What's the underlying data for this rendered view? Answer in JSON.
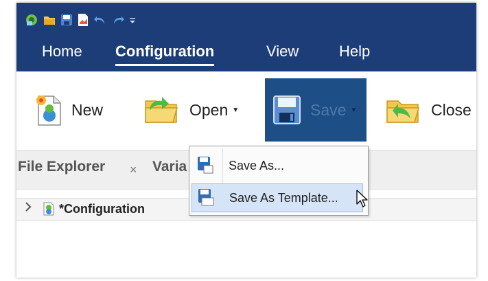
{
  "colors": {
    "titlebar": "#1d3d78",
    "save_active": "#1d4e86",
    "menu_highlight": "#d5e4f7"
  },
  "quick_access": [
    "app-icon",
    "open-folder-icon",
    "save-icon",
    "document-icon",
    "undo-icon",
    "redo-icon",
    "customize-caret"
  ],
  "tabs": [
    "Home",
    "Configuration",
    "View",
    "Help"
  ],
  "ribbon": {
    "new": "New",
    "open": "Open",
    "save": "Save",
    "close": "Close"
  },
  "panel_tabs": {
    "file_explorer": "File Explorer",
    "close_glyph": "×",
    "variables": "Varia"
  },
  "tree": {
    "label": "*Configuration"
  },
  "menu": {
    "save_as": "Save As...",
    "save_as_template": "Save As Template..."
  }
}
